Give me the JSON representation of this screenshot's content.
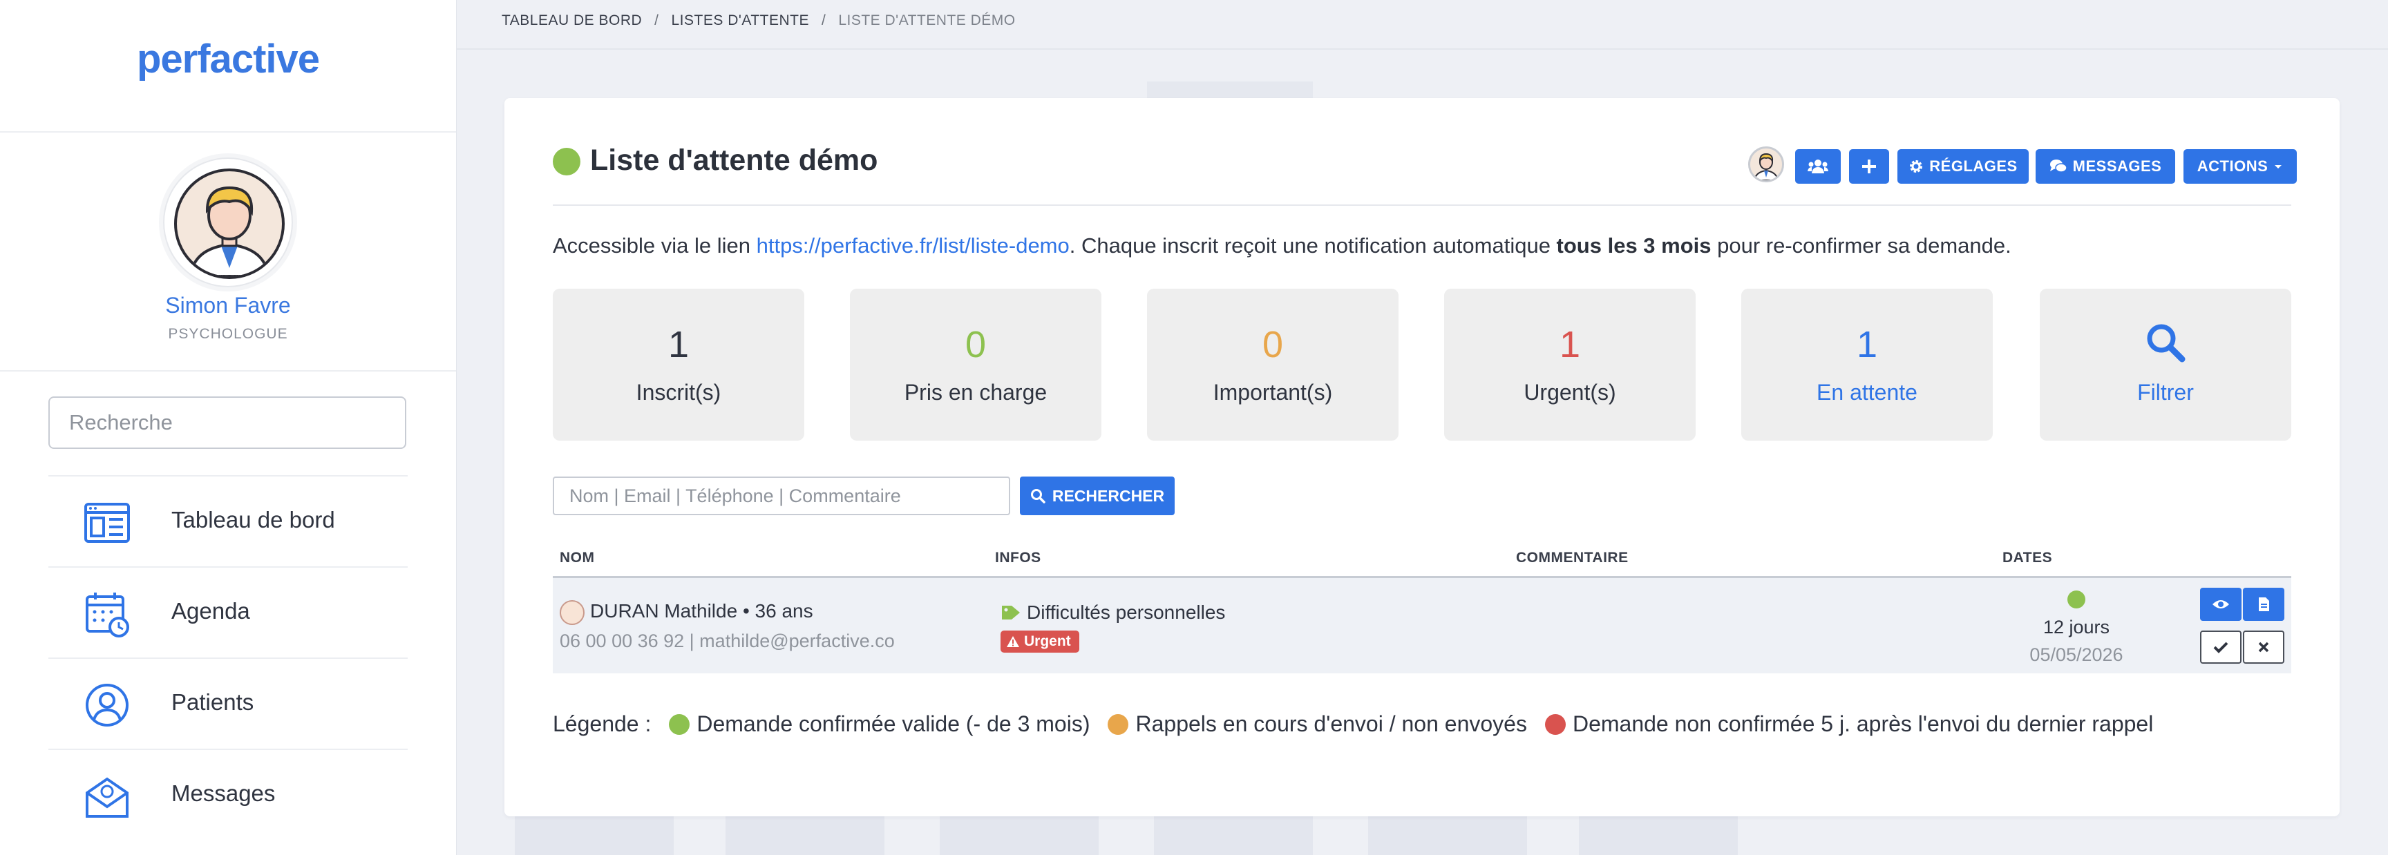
{
  "sidebar": {
    "logo": "perfactive",
    "profile": {
      "name": "Simon Favre",
      "role": "PSYCHOLOGUE"
    },
    "search_placeholder": "Recherche",
    "nav": [
      {
        "label": "Tableau de bord",
        "icon": "dashboard-icon"
      },
      {
        "label": "Agenda",
        "icon": "calendar-icon"
      },
      {
        "label": "Patients",
        "icon": "user-icon"
      },
      {
        "label": "Messages",
        "icon": "mail-icon"
      }
    ]
  },
  "breadcrumb": {
    "items": [
      "TABLEAU DE BORD",
      "LISTES D'ATTENTE"
    ],
    "current": "LISTE D'ATTENTE DÉMO",
    "separator": "/"
  },
  "header": {
    "title": "Liste d'attente démo",
    "status_color": "#8dc14f",
    "buttons": {
      "users": "users-icon",
      "add": "plus-icon",
      "settings": "RÉGLAGES",
      "messages": "MESSAGES",
      "actions": "ACTIONS"
    }
  },
  "description": {
    "prefix": "Accessible via le lien ",
    "link": "https://perfactive.fr/list/liste-demo",
    "middle": ". Chaque inscrit reçoit une notification automatique ",
    "bold": "tous les 3 mois",
    "suffix": " pour re-confirmer sa demande."
  },
  "stats": [
    {
      "value": "1",
      "label": "Inscrit(s)",
      "color": "#2f3440"
    },
    {
      "value": "0",
      "label": "Pris en charge",
      "color": "#8dc14f"
    },
    {
      "value": "0",
      "label": "Important(s)",
      "color": "#e8a64b"
    },
    {
      "value": "1",
      "label": "Urgent(s)",
      "color": "#d9534f"
    },
    {
      "value": "1",
      "label": "En attente",
      "color": "#2f74e6"
    },
    {
      "label": "Filtrer",
      "icon": "search-icon",
      "color": "#2f74e6"
    }
  ],
  "search": {
    "placeholder": "Nom | Email | Téléphone | Commentaire",
    "button": "RECHERCHER"
  },
  "table": {
    "headers": [
      "NOM",
      "INFOS",
      "COMMENTAIRE",
      "DATES"
    ],
    "rows": [
      {
        "name": "DURAN Mathilde • 36 ans",
        "contact": "06 00 00 36 92 | mathilde@perfactive.co",
        "tag": "Difficultés personnelles",
        "badge": "Urgent",
        "comment": "",
        "status_color": "#8dc14f",
        "days": "12 jours",
        "date": "05/05/2026"
      }
    ]
  },
  "legend": {
    "label": "Légende :",
    "items": [
      {
        "text": "Demande confirmée valide (- de 3 mois)",
        "color": "#8dc14f"
      },
      {
        "text": "Rappels en cours d'envoi / non envoyés",
        "color": "#e8a64b"
      },
      {
        "text": "Demande non confirmée 5 j. après l'envoi du dernier rappel",
        "color": "#d9534f"
      }
    ]
  }
}
